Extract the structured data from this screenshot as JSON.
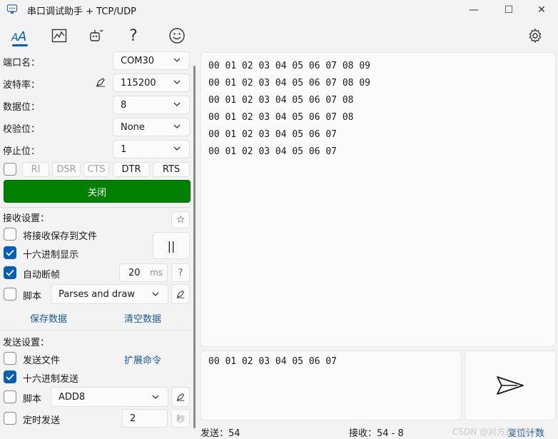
{
  "window": {
    "title": "串口调试助手 + TCP/UDP",
    "minimize": "—",
    "maximize": "☐",
    "close": "✕"
  },
  "serial": {
    "port_label": "端口名：",
    "port_value": "COM30",
    "baud_label": "波特率：",
    "baud_value": "115200",
    "databits_label": "数据位：",
    "databits_value": "8",
    "parity_label": "校验位：",
    "parity_value": "None",
    "stopbits_label": "停止位：",
    "stopbits_value": "1",
    "signals": [
      "RI",
      "DSR",
      "CTS",
      "DTR",
      "RTS"
    ],
    "close_button": "关闭"
  },
  "receive": {
    "section_label": "接收设置：",
    "star": "☆",
    "save_to_file": "将接收保存到文件",
    "hex_display": "十六进制显示",
    "auto_frame": "自动断帧",
    "frame_value": "20",
    "frame_unit": "ms",
    "help": "?",
    "script_label": "脚本",
    "script_value": "Parses and draw",
    "pause": "||",
    "save_data": "保存数据",
    "clear_data": "清空数据"
  },
  "send": {
    "section_label": "发送设置：",
    "send_file": "发送文件",
    "extend_cmd": "扩展命令",
    "hex_send": "十六进制发送",
    "script_label": "脚本",
    "script_value": "ADD8",
    "timed_send": "定时发送",
    "timed_value": "2",
    "timed_unit": "秒",
    "input_text": "00 01 02 03 04 05 06 07"
  },
  "received_lines": [
    "00 01 02 03 04 05 06 07 08 09",
    "00 01 02 03 04 05 06 07 08 09",
    "00 01 02 03 04 05 06 07 08",
    "00 01 02 03 04 05 06 07 08",
    "00 01 02 03 04 05 06 07",
    "00 01 02 03 04 05 06 07"
  ],
  "status": {
    "sent": "发送：54",
    "received": "接收：54 - 8",
    "reset": "复位计数",
    "watermark": "CSDN @对方正在输入..."
  },
  "colors": {
    "accent": "#005fb8",
    "close_button_bg": "#008000"
  }
}
